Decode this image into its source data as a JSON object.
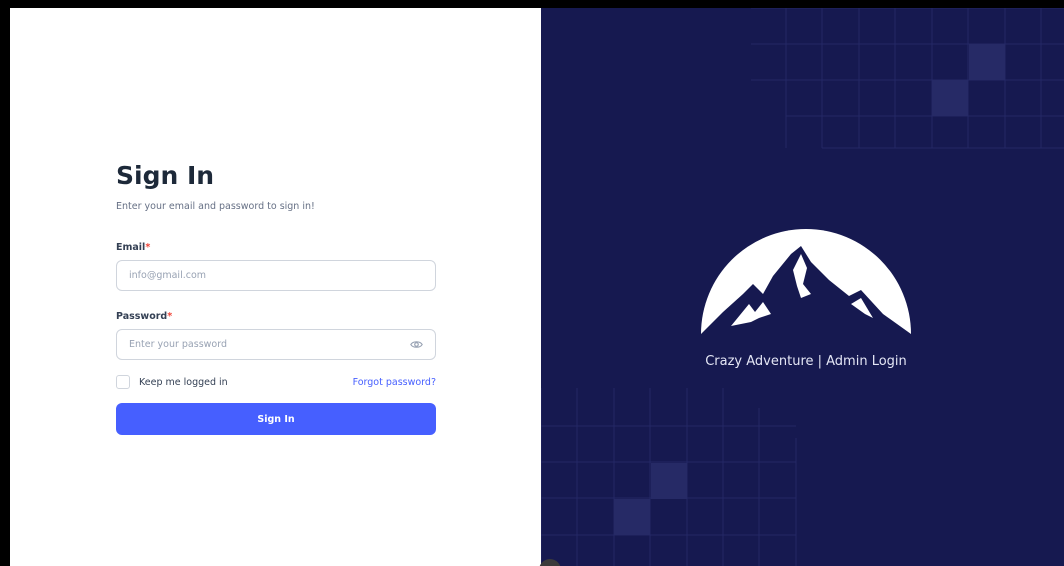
{
  "signin": {
    "title": "Sign In",
    "subtitle": "Enter your email and password to sign in!",
    "email_label": "Email",
    "email_placeholder": "info@gmail.com",
    "email_value": "",
    "password_label": "Password",
    "password_placeholder": "Enter your password",
    "password_value": "",
    "required_mark": "*",
    "keep_logged_in": "Keep me logged in",
    "keep_logged_in_checked": false,
    "forgot_password": "Forgot password?",
    "submit_label": "Sign In",
    "password_visibility_icon": "eye-icon"
  },
  "brand": {
    "text": "Crazy Adventure | Admin Login",
    "logo_icon": "mountain-logo-icon"
  },
  "floating_toggle": {
    "icon": "chevron-down-icon",
    "glyph": "⌄"
  },
  "colors": {
    "accent": "#465fff",
    "brand_bg": "#161950",
    "required": "#f04438",
    "title": "#1d2939"
  }
}
